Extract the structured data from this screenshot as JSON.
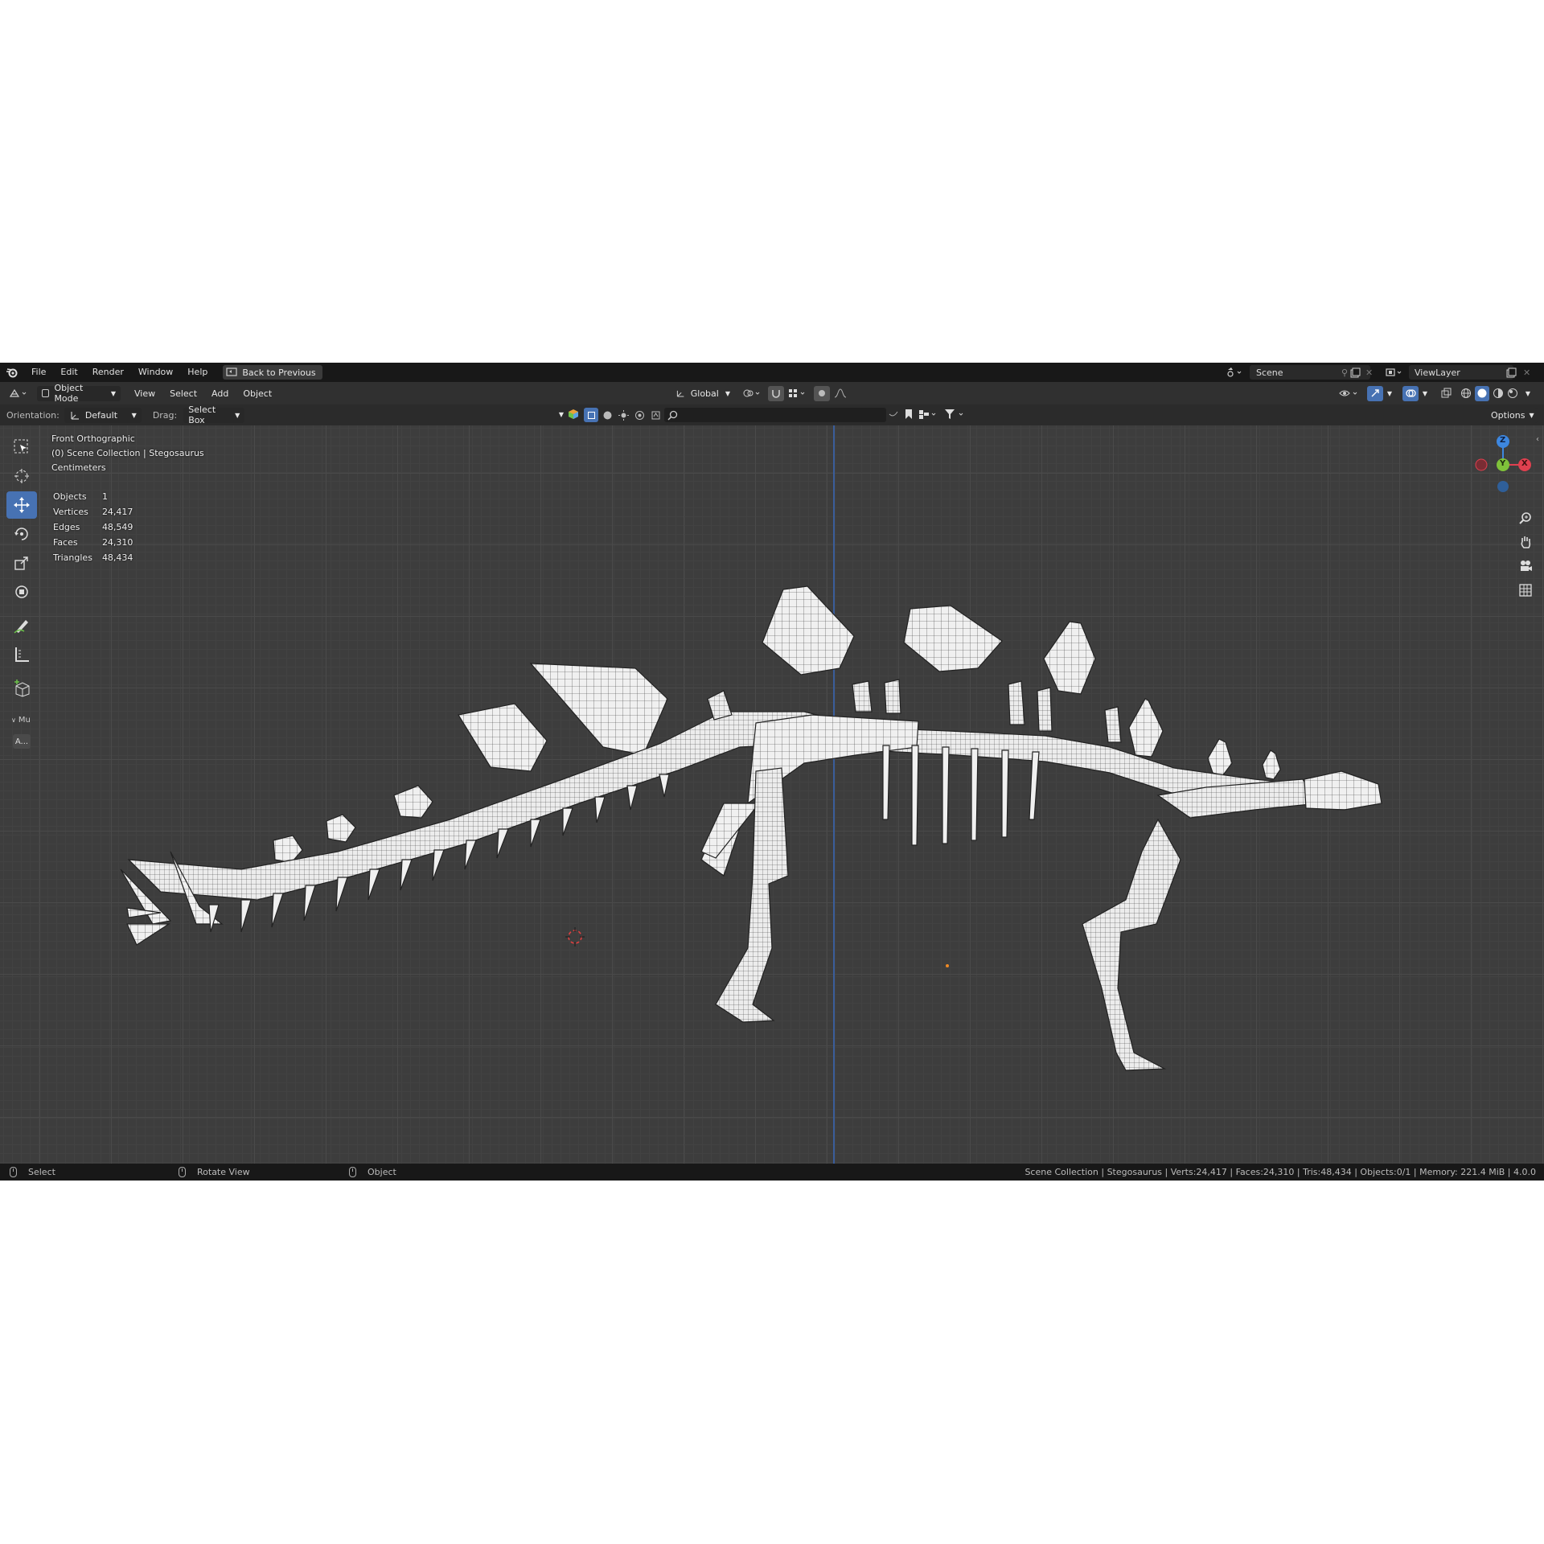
{
  "topbar": {
    "menus": [
      "File",
      "Edit",
      "Render",
      "Window",
      "Help"
    ],
    "back_button": "Back to Previous",
    "scene": "Scene",
    "view_layer": "ViewLayer"
  },
  "header": {
    "mode": "Object Mode",
    "menus": [
      "View",
      "Select",
      "Add",
      "Object"
    ],
    "transform_orientation": "Global"
  },
  "tool_settings": {
    "orientation_label": "Orientation:",
    "orientation_value": "Default",
    "drag_label": "Drag:",
    "drag_value": "Select Box",
    "options_label": "Options"
  },
  "toolbar": {
    "tools": [
      "select-box",
      "cursor",
      "move",
      "rotate",
      "scale",
      "transform",
      "annotate",
      "measure",
      "add-cube"
    ],
    "active_tool": "move",
    "collapsed_panel_label": "Mu",
    "collapsed_button_label": "A..."
  },
  "viewport": {
    "view_name": "Front Orthographic",
    "collection_line": "(0) Scene Collection | Stegosaurus",
    "units": "Centimeters",
    "stats": [
      {
        "label": "Objects",
        "value": "1"
      },
      {
        "label": "Vertices",
        "value": "24,417"
      },
      {
        "label": "Edges",
        "value": "48,549"
      },
      {
        "label": "Faces",
        "value": "24,310"
      },
      {
        "label": "Triangles",
        "value": "48,434"
      }
    ],
    "gizmo": {
      "z": "Z",
      "y": "Y",
      "x": "X"
    }
  },
  "statusbar": {
    "left_action": "Select",
    "middle_action": "Rotate View",
    "right_action": "Object",
    "summary": "Scene Collection | Stegosaurus | Verts:24,417 | Faces:24,310 | Tris:48,434 | Objects:0/1 | Memory: 221.4 MiB | 4.0.0"
  },
  "colors": {
    "viewport_bg": "#3d3d3d",
    "active_tool": "#4772b3",
    "axis_x": "#e0404f",
    "axis_y": "#7fc23a",
    "axis_z": "#3d87e0",
    "mesh": "#f0f0f0"
  }
}
